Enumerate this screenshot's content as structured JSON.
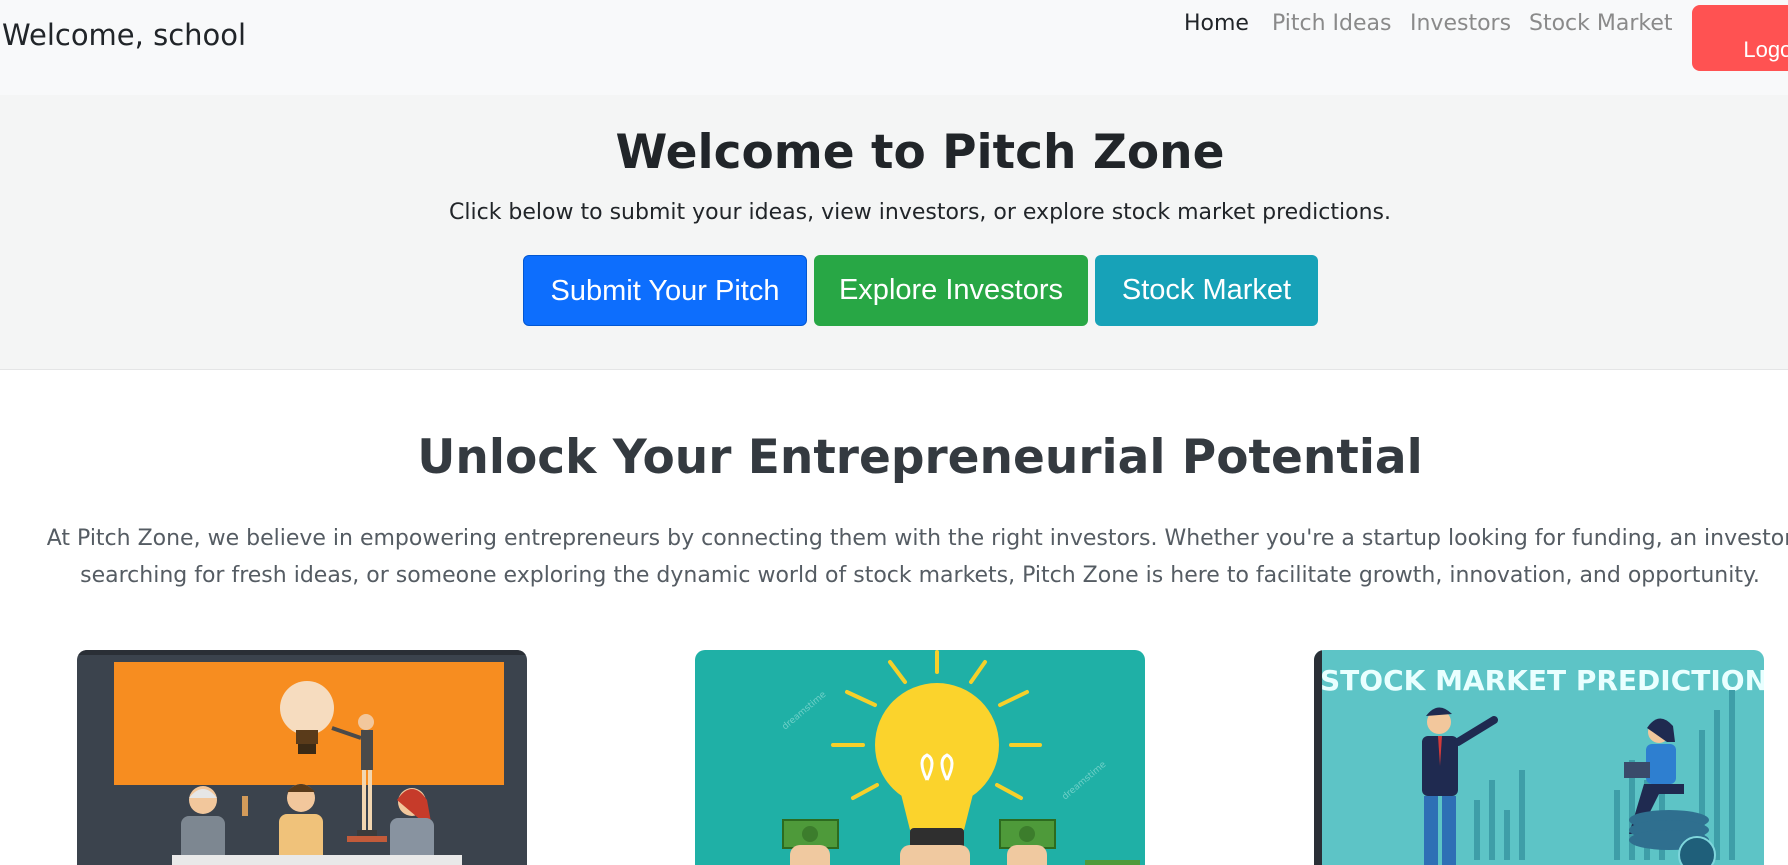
{
  "nav": {
    "brand": "Welcome, school",
    "links": [
      "Home",
      "Pitch Ideas",
      "Investors",
      "Stock Market"
    ],
    "logout": "Logout"
  },
  "hero": {
    "title": "Welcome to Pitch Zone",
    "subtitle": "Click below to submit your ideas, view investors, or explore stock market predictions.",
    "buttons": [
      "Submit Your Pitch",
      "Explore Investors",
      "Stock Market"
    ]
  },
  "about": {
    "title": "Unlock Your Entrepreneurial Potential",
    "text": "At Pitch Zone, we believe in empowering entrepreneurs by connecting them with the right investors. Whether you're a startup looking for funding, an investor searching for fresh ideas, or someone exploring the dynamic world of stock markets, Pitch Zone is here to facilitate growth, innovation, and opportunity."
  },
  "cards": {
    "stock_banner": "STOCK MARKET PREDICTION",
    "watermark": "dreamstime"
  },
  "colors": {
    "navbar_bg": "#f8f9fa",
    "hero_bg": "#f4f5f5",
    "logout": "#ff5252",
    "primary": "#0d6efd",
    "success": "#28a745",
    "info": "#17a2b8"
  }
}
